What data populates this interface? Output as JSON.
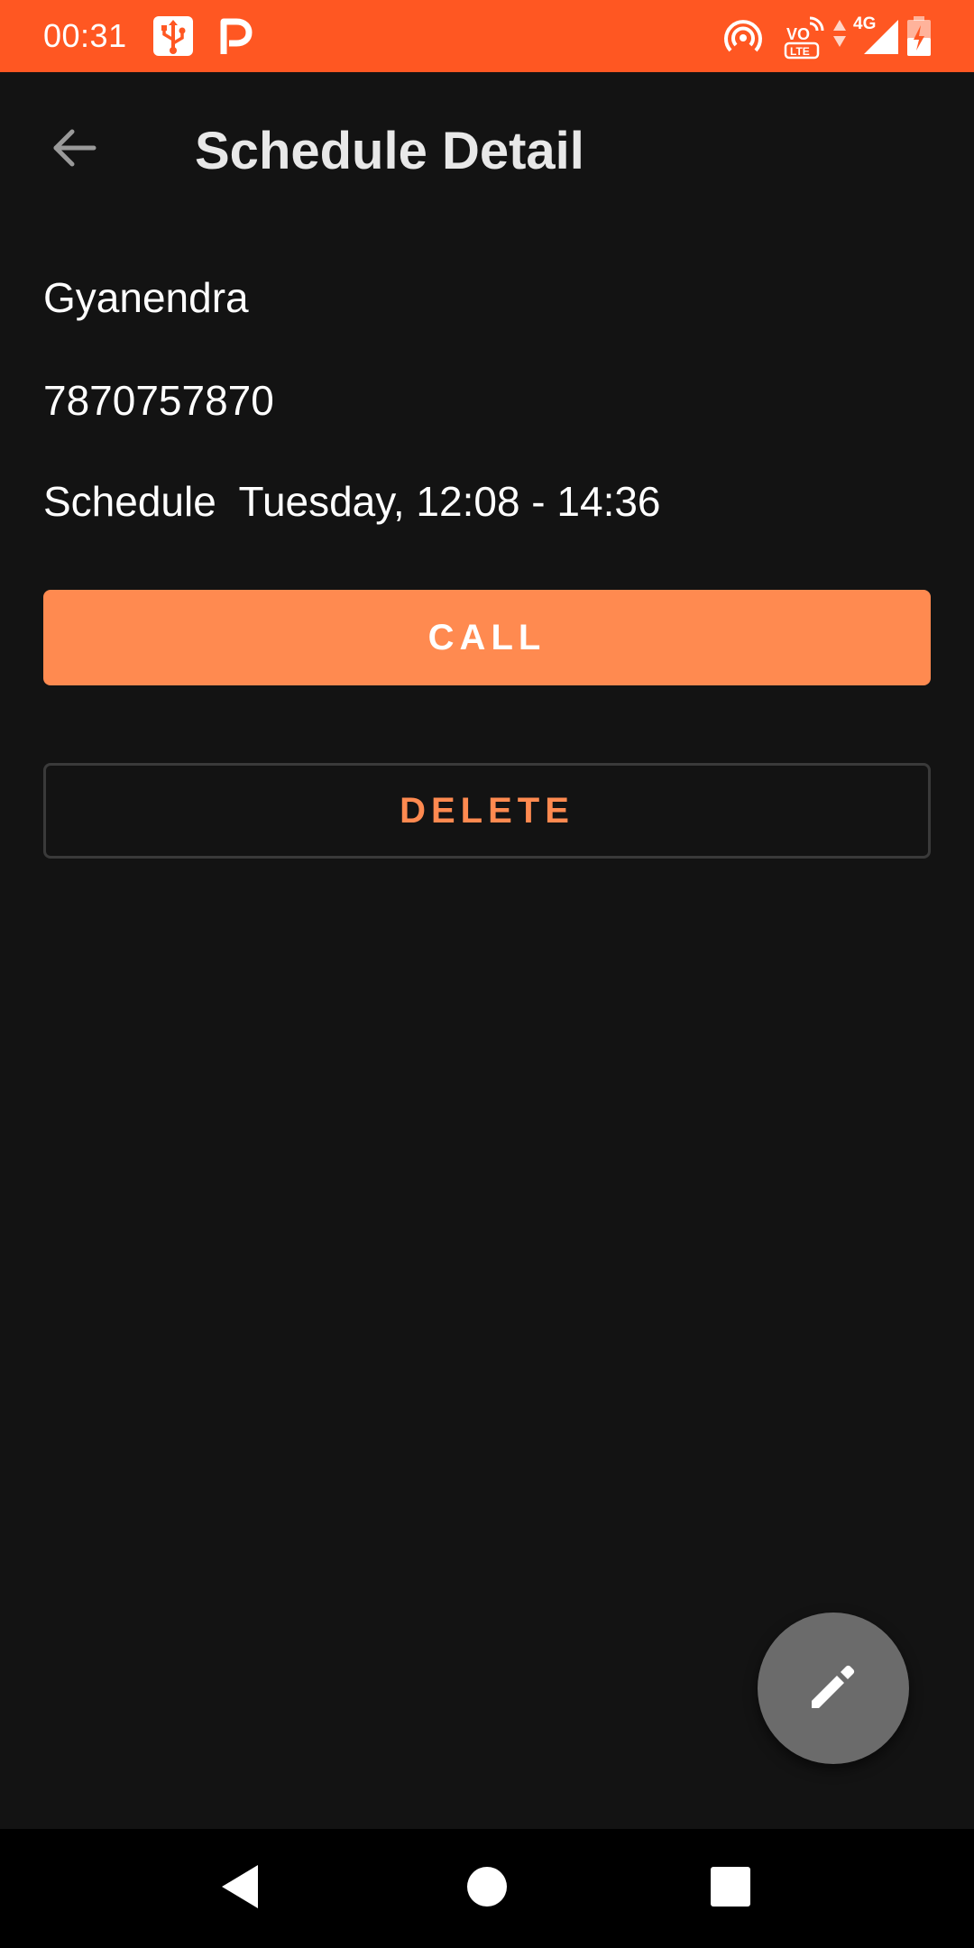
{
  "status_bar": {
    "time": "00:31",
    "background_color": "#ff5722",
    "left_icons": [
      "usb-icon",
      "parking-app-icon"
    ],
    "right_icons": [
      "hotspot-icon",
      "volte-icon",
      "data-arrows-icon",
      "cell-signal-icon",
      "battery-icon"
    ],
    "network_type": "4G",
    "volte_label_top": "VO",
    "volte_label_bottom": "LTE"
  },
  "app_bar": {
    "title": "Schedule Detail",
    "back_icon": "arrow-back-icon"
  },
  "detail": {
    "name": "Gyanendra",
    "phone": "7870757870",
    "schedule": "Schedule  Tuesday, 12:08 - 14:36"
  },
  "actions": {
    "call_label": "CALL",
    "delete_label": "DELETE",
    "accent_color": "#ff8a50"
  },
  "fab": {
    "icon": "pencil-icon"
  },
  "nav_bar": {
    "icons": [
      "nav-back-icon",
      "nav-home-icon",
      "nav-recents-icon"
    ]
  }
}
